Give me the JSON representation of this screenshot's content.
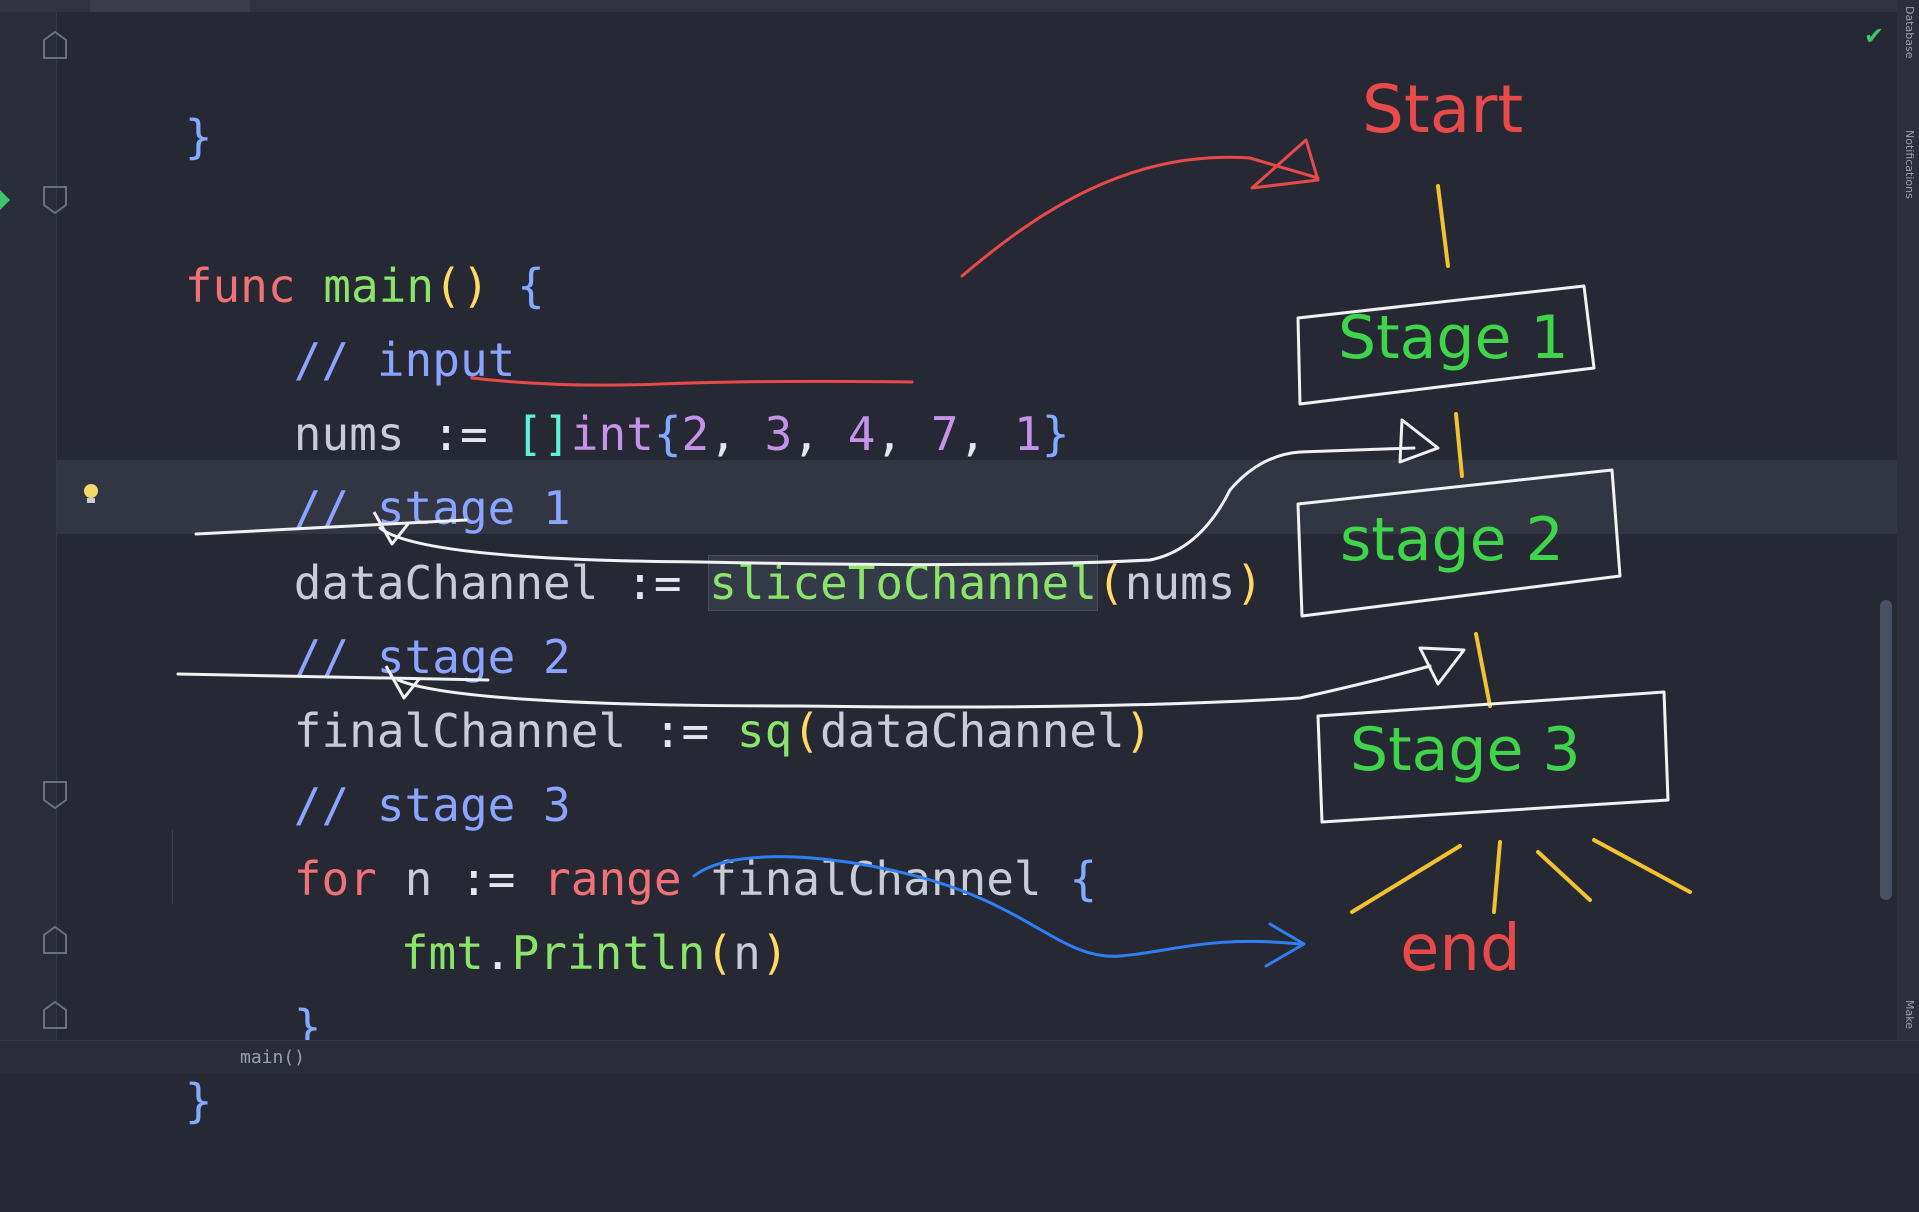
{
  "code": {
    "closing_brace_top": "}",
    "func_kw": "func",
    "func_name": "main",
    "func_parens": "()",
    "func_open": "{",
    "comment_input": "// input",
    "nums_ident": "nums",
    "assign_op": ":=",
    "slice_open": "[]",
    "int_type": "int",
    "brace_open": "{",
    "n2": "2",
    "n3": "3",
    "n4": "4",
    "n7": "7",
    "n1": "1",
    "comma": ",",
    "brace_close": "}",
    "comment_stage1": "// stage 1",
    "dataChannel": "dataChannel",
    "sliceToChannel": "sliceToChannel",
    "paren_open": "(",
    "paren_close": ")",
    "comment_stage2": "// stage 2",
    "finalChannel": "finalChannel",
    "sq": "sq",
    "comment_stage3": "// stage 3",
    "for_kw": "for",
    "n_var": "n",
    "range_kw": "range",
    "fmt": "fmt",
    "dot": ".",
    "println": "Println",
    "inner_close": "}",
    "outer_close": "}"
  },
  "status": {
    "breadcrumb": "main()"
  },
  "sidebar": {
    "database_label": "Database",
    "notifications_label": "Notifications",
    "make_label": "Make"
  },
  "annotations": {
    "start": "Start",
    "stage1": "Stage 1",
    "stage2": "stage 2",
    "stage3": "Stage 3",
    "end": "end"
  },
  "colors": {
    "background": "#262933",
    "keyword": "#f07178",
    "function": "#8be46a",
    "comment": "#8aa4ff",
    "number": "#c792ea",
    "annotation_red": "#e84a4a",
    "annotation_green": "#3fd44a",
    "annotation_yellow": "#f2c230",
    "annotation_white": "#f2f2f2",
    "annotation_blue": "#2f7ff2"
  }
}
